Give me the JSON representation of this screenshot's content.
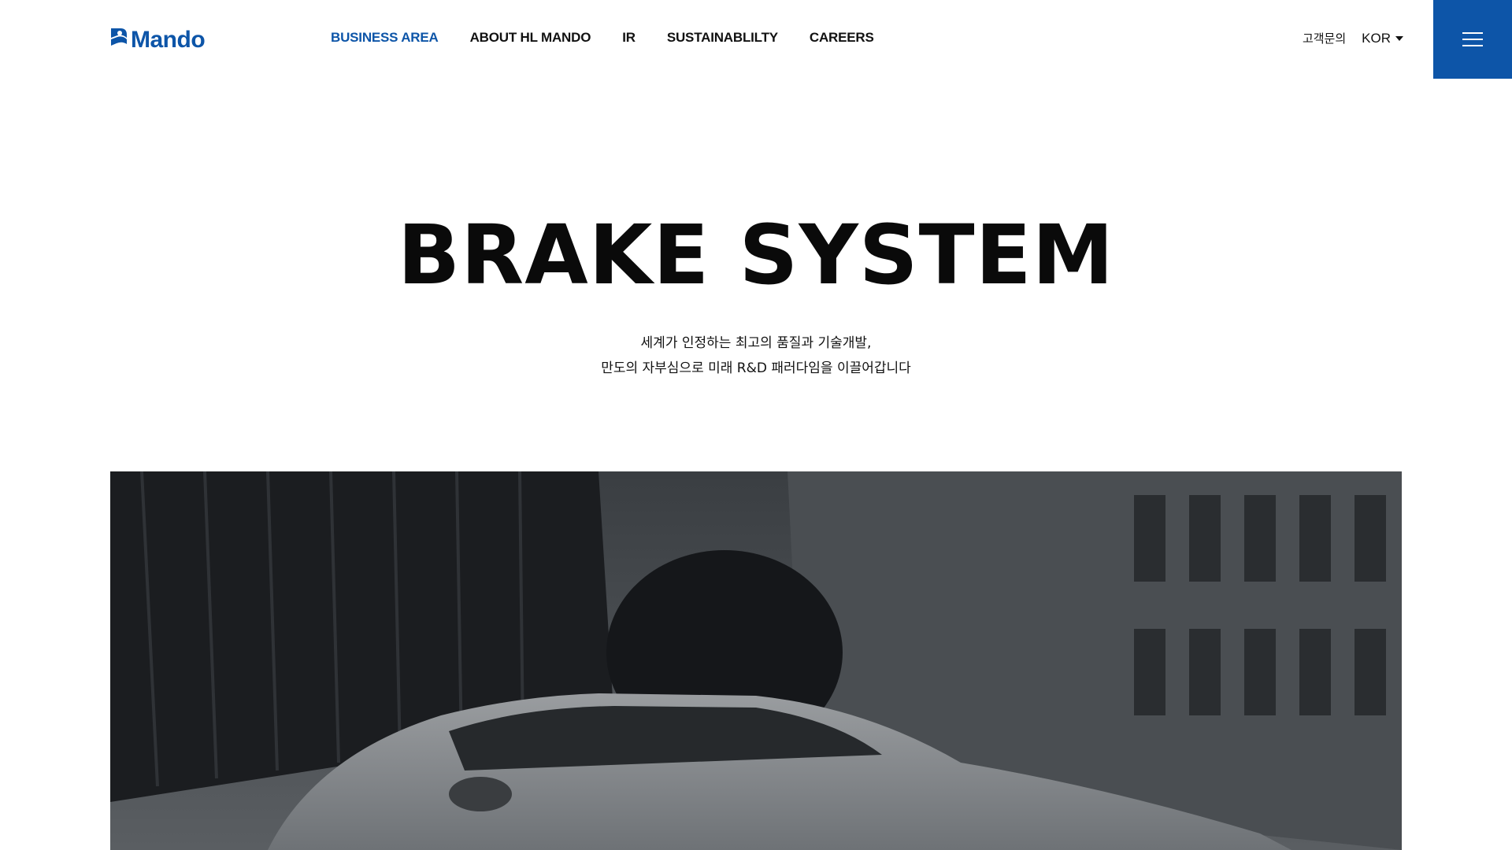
{
  "brand": {
    "name": "Mando",
    "accent": "#0d55a8"
  },
  "nav": {
    "items": [
      {
        "label": "BUSINESS AREA",
        "active": true
      },
      {
        "label": "ABOUT HL MANDO",
        "active": false
      },
      {
        "label": "IR",
        "active": false
      },
      {
        "label": "SUSTAINABLILTY",
        "active": false
      },
      {
        "label": "CAREERS",
        "active": false
      }
    ]
  },
  "utility": {
    "contact_label": "고객문의",
    "language": "KOR",
    "language_icon": "caret-down-icon",
    "menu_icon": "hamburger-menu-icon"
  },
  "hero": {
    "title": "BRAKE SYSTEM",
    "subtitle_line1": "세계가 인정하는 최고의 품질과 기술개발,",
    "subtitle_line2": "만도의 자부심으로 미래 R&D 패러다임을 이끌어갑니다"
  }
}
